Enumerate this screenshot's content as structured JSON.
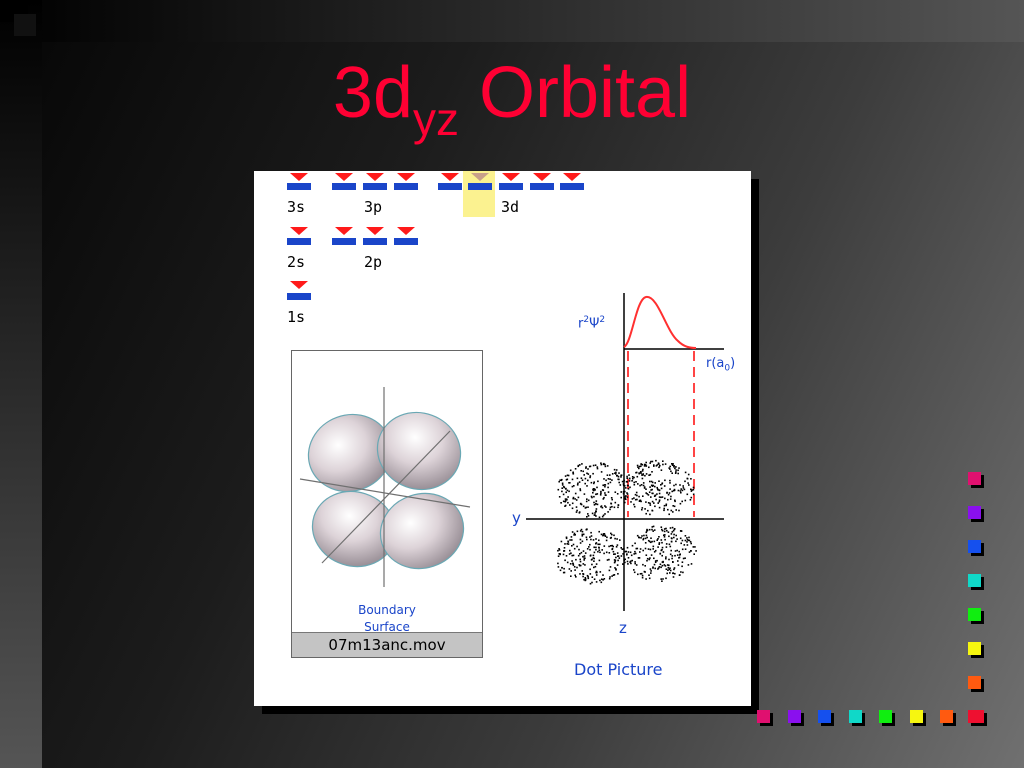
{
  "slide": {
    "title_main": "3d",
    "title_sub": "yz",
    "title_rest": " Orbital"
  },
  "orbital_levels": [
    "3s",
    "3p",
    "3d",
    "2s",
    "2p",
    "1s"
  ],
  "movie": {
    "boundary_line1": "Boundary",
    "boundary_line2": "Surface",
    "filename": "07m13anc.mov"
  },
  "graph": {
    "ylabel_r2": "r",
    "ylabel_sup1": "2",
    "ylabel_psi": "Ψ",
    "ylabel_sup2": "2",
    "xlabel": "r(a",
    "xlabel_sub": "0",
    "xlabel_close": ")",
    "axis_y": "y",
    "axis_z": "z",
    "dot_caption": "Dot Picture"
  },
  "colors": {
    "title": "#ff0033",
    "level_bar": "#1a45c9",
    "electron_arrow": "#ff1a1a",
    "highlight": "#fbf290",
    "deco_squares": [
      "#e0106f",
      "#8a10ee",
      "#1550ee",
      "#10d8c8",
      "#10ee10",
      "#f6f610",
      "#ff5a10",
      "#ee1030"
    ]
  }
}
